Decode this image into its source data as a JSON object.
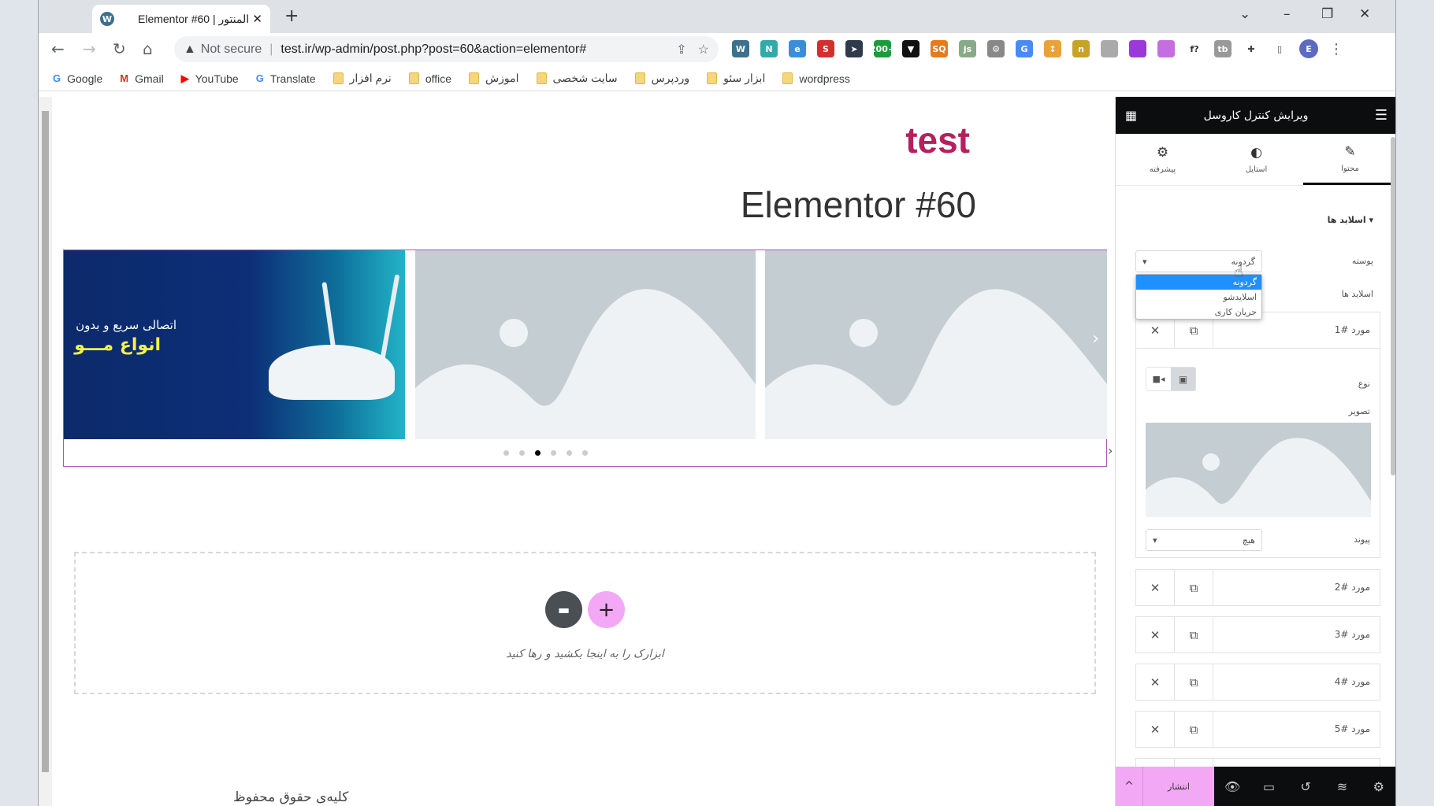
{
  "browser": {
    "tab_title": "Elementor #60 | المنتور",
    "url": "test.ir/wp-admin/post.php?post=60&action=elementor#",
    "security": "Not secure",
    "profile_initial": "E",
    "extensions": [
      {
        "name": "wordpress",
        "color": "#3d6f8f",
        "label": "W"
      },
      {
        "name": "n",
        "color": "#3aa",
        "label": "N"
      },
      {
        "name": "ext-blue",
        "color": "#3a8ed8",
        "label": "e"
      },
      {
        "name": "seo",
        "color": "#d32f2f",
        "label": "S"
      },
      {
        "name": "cursor",
        "color": "#2f3b4a",
        "label": "➤"
      },
      {
        "name": "alexa",
        "color": "#1a9c3a",
        "label": "200+"
      },
      {
        "name": "shield",
        "color": "#111",
        "label": "▼"
      },
      {
        "name": "sq",
        "color": "#e87a1c",
        "label": "SQ"
      },
      {
        "name": "js",
        "color": "#8a8",
        "label": "js"
      },
      {
        "name": "gear",
        "color": "#888",
        "label": "⚙"
      },
      {
        "name": "translate",
        "color": "#4a8af4",
        "label": "G"
      },
      {
        "name": "arrows",
        "color": "#e9a23b",
        "label": "↕"
      },
      {
        "name": "tag",
        "color": "#c7a326",
        "label": "n"
      },
      {
        "name": "gray",
        "color": "#aaa",
        "label": ""
      },
      {
        "name": "picker",
        "color": "#9b39d8",
        "label": ""
      },
      {
        "name": "feather",
        "color": "#c46ee0",
        "label": ""
      },
      {
        "name": "fx",
        "color": "#fff",
        "label": "f?"
      },
      {
        "name": "tb",
        "color": "#999",
        "label": "tb"
      }
    ],
    "bookmarks": [
      {
        "label": "Google",
        "icon": "google"
      },
      {
        "label": "Gmail",
        "icon": "gmail"
      },
      {
        "label": "YouTube",
        "icon": "youtube"
      },
      {
        "label": "Translate",
        "icon": "translate"
      },
      {
        "label": "نرم افزار",
        "icon": "folder"
      },
      {
        "label": "office",
        "icon": "folder"
      },
      {
        "label": "اموزش",
        "icon": "folder"
      },
      {
        "label": "سایت شخصی",
        "icon": "folder"
      },
      {
        "label": "وردپرس",
        "icon": "folder"
      },
      {
        "label": "ابزار سئو",
        "icon": "folder"
      },
      {
        "label": "wordpress",
        "icon": "folder"
      }
    ]
  },
  "canvas": {
    "site_title": "test",
    "page_title": "Elementor #60",
    "banner_line1": "اتصالی سریع و بدون",
    "banner_line2": "انواع مـــو",
    "active_dot": 3,
    "dot_count": 6,
    "dropzone_text": "ابزارک را به اینجا بکشید و رها کنید",
    "footer": "کلیه‌ی حقوق محفوظ"
  },
  "panel": {
    "title": "ویرایش کنترل کاروسل",
    "tabs": [
      {
        "label": "محتوا",
        "icon": "pencil-icon"
      },
      {
        "label": "استایل",
        "icon": "contrast-icon"
      },
      {
        "label": "پیشرفته",
        "icon": "gear-icon"
      }
    ],
    "section": "اسلاید ها",
    "skin_label": "پوسته",
    "skin_value": "گردونه",
    "skin_options": [
      "گردونه",
      "اسلایدشو",
      "جریان کاری"
    ],
    "slides_label": "اسلاید ها",
    "items": [
      "مورد #1",
      "مورد #2",
      "مورد #3",
      "مورد #4",
      "مورد #5"
    ],
    "type_label": "نوع",
    "image_label": "تصویر",
    "link_label": "پیوند",
    "link_value": "هیچ",
    "publish": "انتشار",
    "accent": "#f3a8f5"
  }
}
